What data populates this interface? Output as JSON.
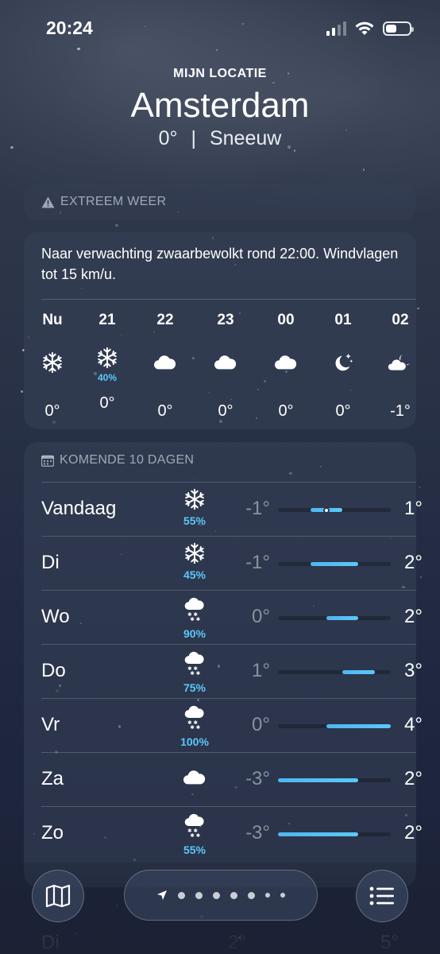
{
  "status_bar": {
    "time": "20:24"
  },
  "header": {
    "location_label": "MIJN LOCATIE",
    "city": "Amsterdam",
    "temperature": "0°",
    "separator": "|",
    "condition": "Sneeuw"
  },
  "alert": {
    "label": "EXTREEM WEER",
    "text": "Naar verwachting zwaarbewolkt rond 22:00. Windvlagen tot 15 km/u."
  },
  "hourly": [
    {
      "hour": "Nu",
      "icon": "snowflake-icon",
      "precip": "",
      "temp": "0°"
    },
    {
      "hour": "21",
      "icon": "snowflake-icon",
      "precip": "40%",
      "temp": "0°"
    },
    {
      "hour": "22",
      "icon": "cloud-icon",
      "precip": "",
      "temp": "0°"
    },
    {
      "hour": "23",
      "icon": "cloud-icon",
      "precip": "",
      "temp": "0°"
    },
    {
      "hour": "00",
      "icon": "cloud-icon",
      "precip": "",
      "temp": "0°"
    },
    {
      "hour": "01",
      "icon": "moon-stars-icon",
      "precip": "",
      "temp": "0°"
    },
    {
      "hour": "02",
      "icon": "cloud-moon-icon",
      "precip": "",
      "temp": "-1°"
    }
  ],
  "daily": {
    "label": "KOMENDE 10 DAGEN",
    "range_min": -3,
    "range_max": 4,
    "days": [
      {
        "day": "Vandaag",
        "icon": "snowflake-icon",
        "precip": "55%",
        "low": "-1°",
        "high": "1°",
        "low_v": -1,
        "high_v": 1,
        "current_v": 0
      },
      {
        "day": "Di",
        "icon": "snowflake-icon",
        "precip": "45%",
        "low": "-1°",
        "high": "2°",
        "low_v": -1,
        "high_v": 2
      },
      {
        "day": "Wo",
        "icon": "cloud-snow-icon",
        "precip": "90%",
        "low": "0°",
        "high": "2°",
        "low_v": 0,
        "high_v": 2
      },
      {
        "day": "Do",
        "icon": "cloud-snow-icon",
        "precip": "75%",
        "low": "1°",
        "high": "3°",
        "low_v": 1,
        "high_v": 3
      },
      {
        "day": "Vr",
        "icon": "cloud-snow-icon",
        "precip": "100%",
        "low": "0°",
        "high": "4°",
        "low_v": 0,
        "high_v": 4
      },
      {
        "day": "Za",
        "icon": "cloud-icon",
        "precip": "",
        "low": "-3°",
        "high": "2°",
        "low_v": -3,
        "high_v": 2
      },
      {
        "day": "Zo",
        "icon": "cloud-snow-icon",
        "precip": "55%",
        "low": "-3°",
        "high": "2°",
        "low_v": -3,
        "high_v": 2
      }
    ],
    "partial_day": {
      "day": "Di",
      "low": "2°",
      "high": "5°"
    }
  },
  "bottom_bar": {
    "page_count": 8,
    "current_page": 0
  },
  "colors": {
    "accent": "#5ac8fa",
    "background": "#273045"
  }
}
